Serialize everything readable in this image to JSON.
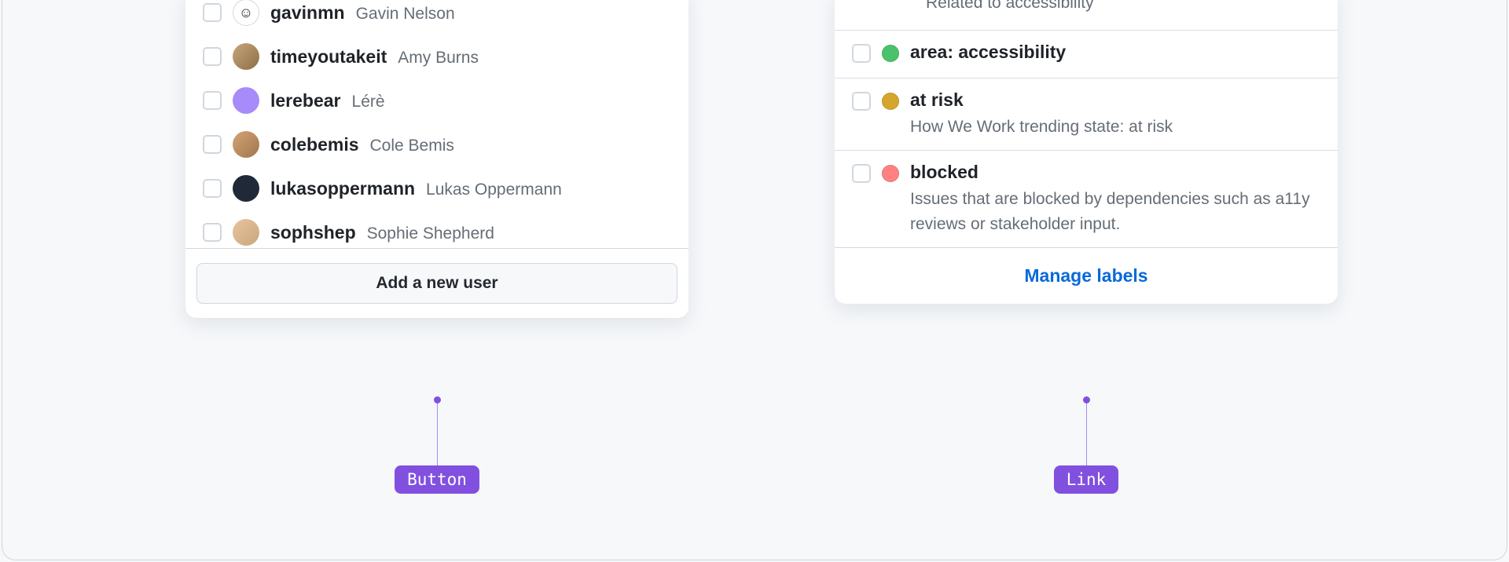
{
  "left_panel": {
    "users": [
      {
        "username": "gavinmn",
        "realname": "Gavin Nelson"
      },
      {
        "username": "timeyoutakeit",
        "realname": "Amy Burns"
      },
      {
        "username": "lerebear",
        "realname": "Lérè"
      },
      {
        "username": "colebemis",
        "realname": "Cole Bemis"
      },
      {
        "username": "lukasoppermann",
        "realname": "Lukas Oppermann"
      },
      {
        "username": "sophshep",
        "realname": "Sophie Shepherd"
      }
    ],
    "footer_button": "Add a new user"
  },
  "right_panel": {
    "partial_desc": "Related to accessibility",
    "labels": [
      {
        "name": "area: accessibility",
        "color": "green"
      },
      {
        "name": "at risk",
        "color": "yellow",
        "desc": "How We Work trending state: at risk"
      },
      {
        "name": "blocked",
        "color": "red",
        "desc": "Issues that are blocked by dependencies such as a11y reviews or stakeholder input."
      }
    ],
    "footer_link": "Manage labels"
  },
  "callouts": {
    "left": "Button",
    "right": "Link"
  }
}
